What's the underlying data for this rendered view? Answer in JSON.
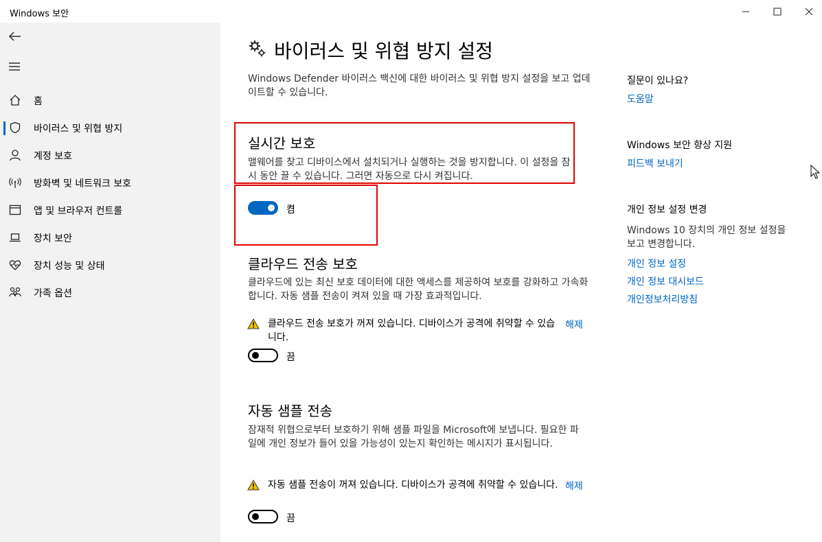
{
  "window": {
    "title": "Windows 보안",
    "minimize_glyph": "—",
    "maximize_glyph": "☐",
    "close_glyph": "✕"
  },
  "sidebar": {
    "items": [
      {
        "label": "홈",
        "icon": "home-icon"
      },
      {
        "label": "바이러스 및 위협 방지",
        "icon": "shield-icon",
        "active": true
      },
      {
        "label": "계정 보호",
        "icon": "person-icon"
      },
      {
        "label": "방화벽 및 네트워크 보호",
        "icon": "wifi-icon"
      },
      {
        "label": "앱 및 브라우저 컨트롤",
        "icon": "browser-icon"
      },
      {
        "label": "장치 보안",
        "icon": "laptop-icon"
      },
      {
        "label": "장치 성능 및 상태",
        "icon": "heart-icon"
      },
      {
        "label": "가족 옵션",
        "icon": "family-icon"
      }
    ]
  },
  "main": {
    "title": "바이러스 및 위협 방지 설정",
    "description": "Windows Defender 바이러스 백신에 대한 바이러스 및 위협 방지 설정을 보고 업데이트할 수 있습니다.",
    "realtime": {
      "title": "실시간 보호",
      "description": "맬웨어를 찾고 디바이스에서 설치되거나 실행하는 것을 방지합니다. 이 설정을 잠시 동안 끌 수 있습니다. 그러면 자동으로 다시 켜집니다.",
      "state_label": "켬",
      "on": true
    },
    "cloud": {
      "title": "클라우드 전송 보호",
      "description": "클라우드에 있는 최신 보호 데이터에 대한 액세스를 제공하여 보호를 강화하고 가속화합니다. 자동 샘플 전송이 켜져 있을 때 가장 효과적입니다.",
      "warning": "클라우드 전송 보호가 꺼져 있습니다. 디바이스가 공격에 취약할 수 있습니다.",
      "dismiss": "해제",
      "state_label": "끔",
      "on": false
    },
    "sample": {
      "title": "자동 샘플 전송",
      "description": "잠재적 위협으로부터 보호하기 위해 샘플 파일을 Microsoft에 보냅니다. 필요한 파일에 개인 정보가 들어 있을 가능성이 있는지 확인하는 메시지가 표시됩니다.",
      "warning": "자동 샘플 전송이 꺼져 있습니다. 디바이스가 공격에 취약할 수 있습니다.",
      "dismiss": "해제",
      "state_label": "끔",
      "on": false
    }
  },
  "right_panel": {
    "question": "질문이 있나요?",
    "help_link": "도움말",
    "improve_heading": "Windows 보안 향상 지원",
    "feedback_link": "피드백 보내기",
    "privacy_heading": "개인 정보 설정 변경",
    "privacy_text": "Windows 10 장치의 개인 정보 설정을 보고 변경합니다.",
    "privacy_links": [
      "개인 정보 설정",
      "개인 정보 대시보드",
      "개인정보처리방침"
    ]
  },
  "colors": {
    "accent": "#0067c0",
    "highlight_box": "#e00000",
    "warning": "#f2c200",
    "sidebar_bg": "#f2f2f2"
  }
}
